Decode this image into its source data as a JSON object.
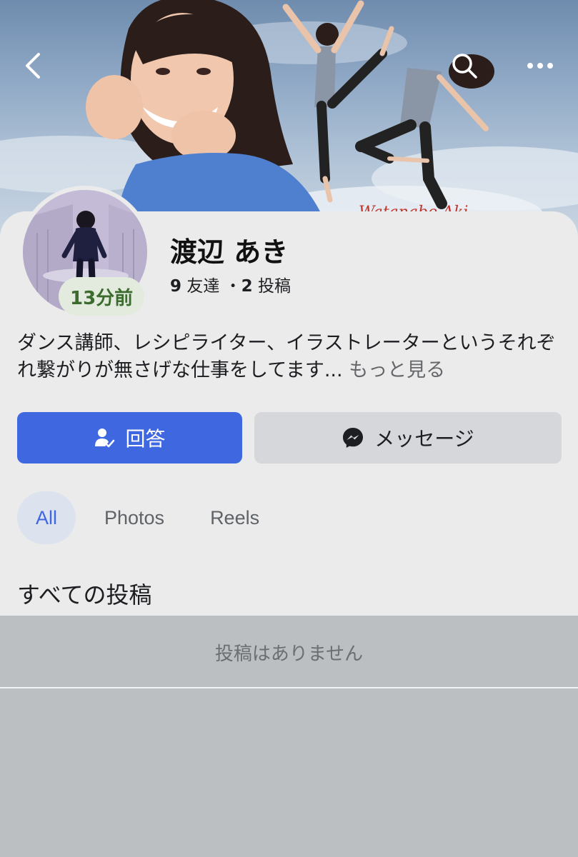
{
  "header": {
    "back_icon": "chevron-left-icon",
    "search_icon": "search-icon",
    "more_icon": "more-horizontal-icon"
  },
  "cover": {
    "signature_text": "Watanabe Aki"
  },
  "profile": {
    "name": "渡辺 あき",
    "friends_count": "9",
    "friends_label": "友達",
    "separator": "・",
    "posts_count": "2",
    "posts_label": "投稿",
    "last_active": "13分前",
    "bio": "ダンス講師、レシピライター、イラストレーターというそれぞれ繋がりが無さげな仕事をしてます...",
    "see_more": "もっと見る"
  },
  "actions": {
    "respond_label": "回答",
    "respond_icon": "person-check-icon",
    "message_label": "メッセージ",
    "message_icon": "messenger-icon"
  },
  "tabs": [
    {
      "label": "All",
      "active": true
    },
    {
      "label": "Photos",
      "active": false
    },
    {
      "label": "Reels",
      "active": false
    }
  ],
  "posts_section": {
    "title": "すべての投稿",
    "empty_text": "投稿はありません"
  },
  "colors": {
    "accent": "#3f67e0",
    "badge_green": "#3b6c2e",
    "card_bg": "#ebebeb",
    "page_bg": "#bcbfc2"
  }
}
